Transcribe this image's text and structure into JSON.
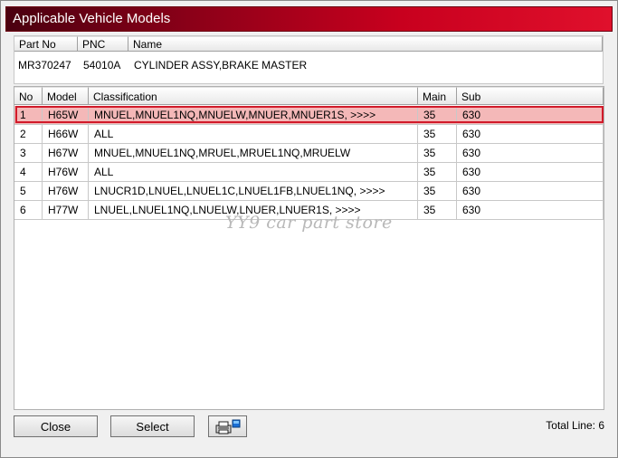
{
  "window": {
    "title": "Applicable Vehicle Models"
  },
  "part": {
    "headers": [
      "Part No",
      "PNC",
      "Name"
    ],
    "part_no": "MR370247",
    "pnc": "54010A",
    "name": "CYLINDER ASSY,BRAKE MASTER"
  },
  "grid": {
    "headers": [
      "No",
      "Model",
      "Classification",
      "Main",
      "Sub"
    ],
    "rows": [
      {
        "no": "1",
        "model": "H65W",
        "classification": "MNUEL,MNUEL1NQ,MNUELW,MNUER,MNUER1S,  >>>>",
        "main": "35",
        "sub": "630"
      },
      {
        "no": "2",
        "model": "H66W",
        "classification": "ALL",
        "main": "35",
        "sub": "630"
      },
      {
        "no": "3",
        "model": "H67W",
        "classification": "MNUEL,MNUEL1NQ,MRUEL,MRUEL1NQ,MRUELW",
        "main": "35",
        "sub": "630"
      },
      {
        "no": "4",
        "model": "H76W",
        "classification": "ALL",
        "main": "35",
        "sub": "630"
      },
      {
        "no": "5",
        "model": "H76W",
        "classification": "LNUCR1D,LNUEL,LNUEL1C,LNUEL1FB,LNUEL1NQ,  >>>>",
        "main": "35",
        "sub": "630"
      },
      {
        "no": "6",
        "model": "H77W",
        "classification": "LNUEL,LNUEL1NQ,LNUELW,LNUER,LNUER1S,  >>>>",
        "main": "35",
        "sub": "630"
      }
    ],
    "selected_row": 1
  },
  "watermark": "YY9 car part store",
  "footer": {
    "close_label": "Close",
    "select_label": "Select",
    "print_icon": "printer-icon",
    "total_line": "Total Line: 6"
  },
  "colors": {
    "title_gradient_start": "#4a0010",
    "title_gradient_end": "#e0102c",
    "selected_row_bg": "#f4b8b8",
    "selected_outline": "#d11a2a"
  }
}
